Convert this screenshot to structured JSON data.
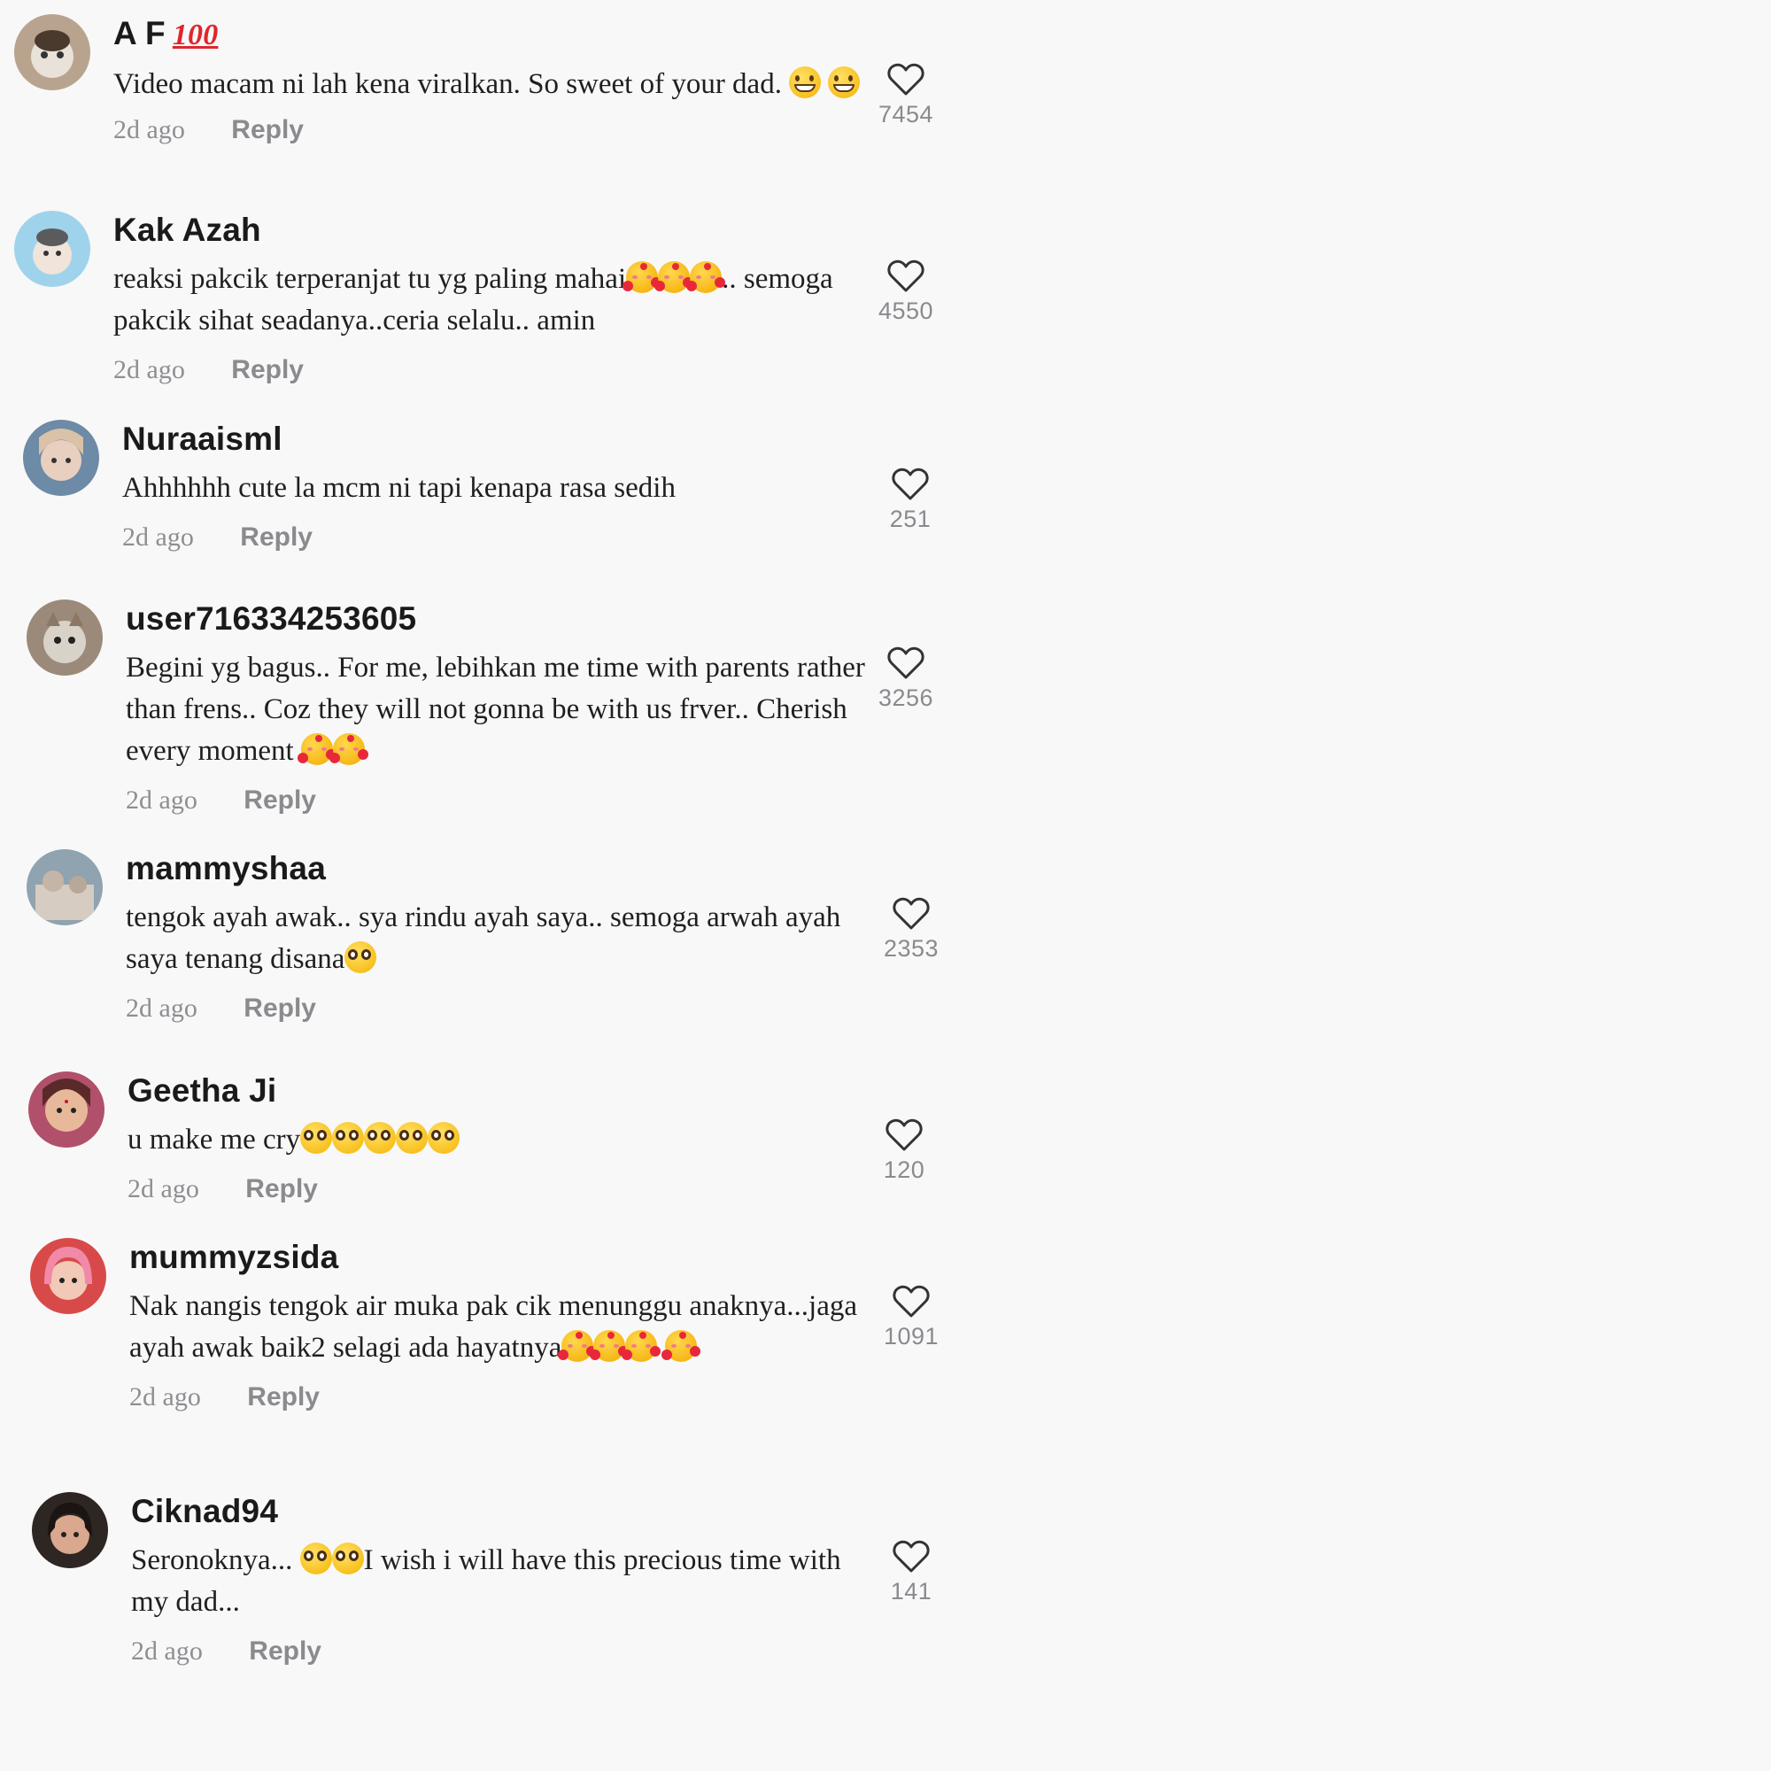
{
  "comments": [
    {
      "username": "A F",
      "badge": "100",
      "text": "Video macam ni lah kena viralkan. So sweet of your dad.",
      "emojis_after": [
        "grin",
        "grin"
      ],
      "time": "2d ago",
      "reply_label": "Reply",
      "likes": "7454",
      "avatar_colors": [
        "#b8a48e",
        "#e9e2d8"
      ]
    },
    {
      "username": "Kak Azah",
      "text_parts": [
        "reaksi pakcik terperanjat tu yg paling mahai",
        "..",
        " semoga pakcik sihat seadanya..ceria selalu.. amin"
      ],
      "emojis_mid": [
        "hearts",
        "hearts",
        "hearts"
      ],
      "time": "2d ago",
      "reply_label": "Reply",
      "likes": "4550",
      "avatar_colors": [
        "#9fd3ec",
        "#f1e4da"
      ]
    },
    {
      "username": "Nuraaisml",
      "text": "Ahhhhhh cute la mcm ni tapi kenapa rasa sedih",
      "time": "2d ago",
      "reply_label": "Reply",
      "likes": "251",
      "avatar_colors": [
        "#6d8aa6",
        "#e8cfc0"
      ]
    },
    {
      "username": "user716334253605",
      "text": "Begini yg bagus.. For me, lebihkan me time with parents rather than frens.. Coz they will not gonna be with us frver.. Cherish every moment ",
      "emojis_after": [
        "hearts",
        "hearts"
      ],
      "time": "2d ago",
      "reply_label": "Reply",
      "likes": "3256",
      "avatar_colors": [
        "#9b8a7a",
        "#d9d2c8"
      ]
    },
    {
      "username": "mammyshaa",
      "text": "tengok ayah awak.. sya rindu ayah saya.. semoga arwah ayah saya tenang disana",
      "emojis_after": [
        "plead"
      ],
      "time": "2d ago",
      "reply_label": "Reply",
      "likes": "2353",
      "avatar_colors": [
        "#8fa3b0",
        "#d6ccc2"
      ]
    },
    {
      "username": "Geetha Ji",
      "text": "u make me cry",
      "emojis_after": [
        "plead",
        "plead",
        "plead",
        "plead",
        "plead"
      ],
      "time": "2d ago",
      "reply_label": "Reply",
      "likes": "120",
      "avatar_colors": [
        "#b0506a",
        "#e7b89a"
      ]
    },
    {
      "username": "mummyzsida",
      "text": "Nak nangis tengok air muka pak cik menunggu anaknya...jaga ayah awak baik2 selagi ada hayatnya",
      "emojis_after": [
        "hearts",
        "hearts",
        "hearts",
        "hearts"
      ],
      "time": "2d ago",
      "reply_label": "Reply",
      "likes": "1091",
      "avatar_colors": [
        "#d84a4a",
        "#f2c9b6"
      ]
    },
    {
      "username": "Ciknad94",
      "text_parts": [
        "Seronoknya... ",
        "I wish i will have this precious time with my dad..."
      ],
      "emojis_mid": [
        "plead",
        "plead"
      ],
      "time": "2d ago",
      "reply_label": "Reply",
      "likes": "141",
      "avatar_colors": [
        "#2e2622",
        "#d9a88e"
      ]
    }
  ]
}
